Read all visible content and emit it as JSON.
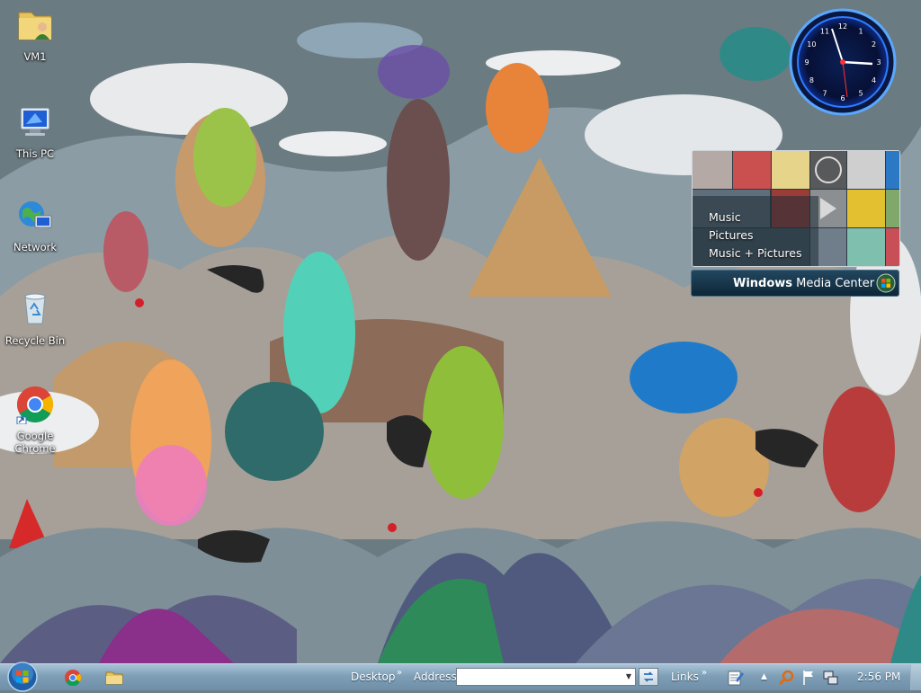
{
  "desktop": {
    "icons": [
      {
        "label": "VM1",
        "icon": "user-folder-icon"
      },
      {
        "label": "This PC",
        "icon": "computer-icon"
      },
      {
        "label": "Network",
        "icon": "network-icon"
      },
      {
        "label": "Recycle Bin",
        "icon": "recycle-bin-icon"
      },
      {
        "label": "Google Chrome",
        "icon": "chrome-icon"
      }
    ]
  },
  "gadgets": {
    "clock": {
      "numbers": [
        "12",
        "1",
        "2",
        "3",
        "4",
        "5",
        "6",
        "7",
        "8",
        "9",
        "10",
        "11"
      ]
    },
    "media_center": {
      "menu": [
        "Music",
        "Pictures",
        "Music + Pictures"
      ],
      "brand_bold": "Windows",
      "brand_rest": " Media Center"
    }
  },
  "taskbar": {
    "toolbar_desktop": "Desktop",
    "toolbar_address": "Address",
    "address_value": "",
    "toolbar_links": "Links",
    "chevron": "»",
    "time": "2:56 PM",
    "pinned": [
      "chrome-icon",
      "file-explorer-icon"
    ],
    "tray": [
      "show-hidden-icon",
      "search-icon",
      "action-center-flag-icon",
      "network-tray-icon"
    ]
  },
  "colors": {
    "taskbar_top": "#a9c3d6",
    "taskbar_bottom": "#6d8fa7",
    "wmc_bar": "#0e2638",
    "clock_ring": "#1f6fff"
  }
}
